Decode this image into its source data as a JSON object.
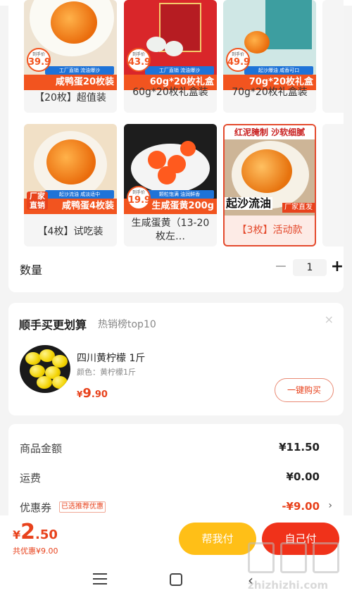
{
  "variants": [
    {
      "caption": "【20枚】超值装",
      "banner": "咸鸭蛋20枚装",
      "subline": "工厂直销 流油爆沙",
      "price_label": "到手价",
      "price": "39.9"
    },
    {
      "caption": "60g*20枚礼盒装",
      "banner": "60g*20枚礼盒",
      "subline": "工厂直销 流油爆沙",
      "price_label": "到手价",
      "price": "43.9"
    },
    {
      "caption": "70g*20枚礼盒装",
      "banner": "70g*20枚礼盒",
      "subline": "起沙爆油 咸香可口",
      "price_label": "到手价",
      "price": "49.9"
    },
    {
      "caption": "【4枚】试吃装",
      "banner": "咸鸭蛋4枚装",
      "subline": "起沙流油 咸淡适中",
      "tag": "厂家直销"
    },
    {
      "caption": "生咸蛋黄（13-20枚左…",
      "banner": "生咸蛋黄200g",
      "subline": "颗粒饱满 油润鲜香",
      "price_label": "到手价",
      "price": "19.9"
    },
    {
      "caption": "【3枚】活动款",
      "top_banner": "红泥腌制 沙软细腻",
      "bottom_text": "起沙流油",
      "tag": "厂家直发"
    }
  ],
  "quantity": {
    "label": "数量",
    "minus": "−",
    "value": "1",
    "plus": "+"
  },
  "upsell": {
    "title": "顺手买更划算",
    "subtitle": "热销榜top10",
    "close": "×",
    "product": {
      "name": "四川黄柠檬 1斤",
      "attr": "颜色：黄柠檬1斤",
      "price_yen": "¥",
      "price_int": "9",
      "price_dec": ".90",
      "buy_label": "一键购买"
    }
  },
  "summary": {
    "goods_label": "商品金额",
    "goods_value": "¥11.50",
    "shipping_label": "运费",
    "shipping_value": "¥0.00",
    "coupon_label": "优惠券",
    "coupon_tag": "已选推荐优惠",
    "coupon_value": "-¥9.00",
    "chevron": "›"
  },
  "bottom": {
    "total_yen": "¥",
    "total_int": "2",
    "total_dec": ".50",
    "saved": "共优惠¥9.00",
    "help_pay": "帮我付",
    "self_pay": "自己付"
  },
  "watermark": "zhizhizhi.com",
  "colors": {
    "accent": "#f0321a",
    "help_btn": "#ffbf17",
    "price": "#e8421c"
  }
}
